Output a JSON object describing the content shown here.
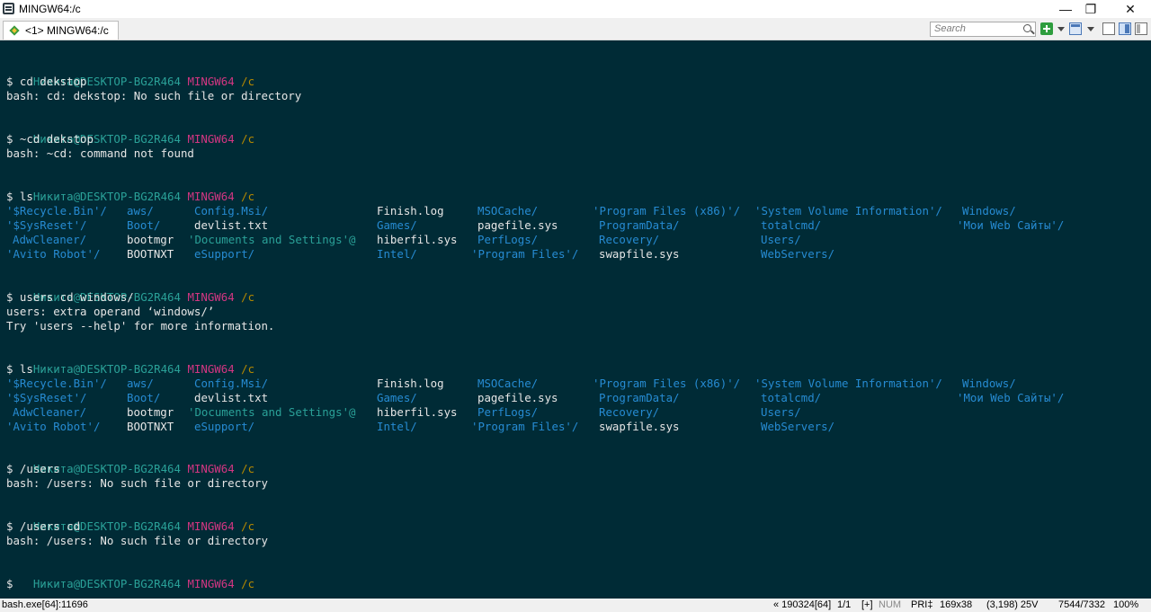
{
  "window": {
    "title": "MINGW64:/c",
    "tab_label": "<1> MINGW64:/c",
    "search_placeholder": "Search",
    "minimize": "—",
    "restore": "❐",
    "close": "✕"
  },
  "prompt": {
    "user": "Никита@DESKTOP-BG2R464",
    "system": "MINGW64",
    "path": "/c"
  },
  "terminal": {
    "cmd1": "$ cd dekstop",
    "out1": "bash: cd: dekstop: No such file or directory",
    "cmd2": "$ ~cd dekstop",
    "out2": "bash: ~cd: command not found",
    "cmd3": "$ ls",
    "cmd4": "$ users cd windows/",
    "out4a": "users: extra operand ‘windows/’",
    "out4b": "Try 'users --help' for more information.",
    "cmd5": "$ ls",
    "cmd6": "$ /users",
    "out6": "bash: /users: No such file or directory",
    "cmd7": "$ /users cd",
    "out7": "bash: /users: No such file or directory",
    "cmd8": "$"
  },
  "ls_listing": [
    [
      "'$Recycle.Bin'/",
      "aws/",
      "Config.Msi/",
      "Finish.log",
      "MSOCache/",
      "'Program Files (x86)'/",
      "'System Volume Information'/",
      "Windows/"
    ],
    [
      "'$SysReset'/",
      "Boot/",
      "devlist.txt",
      "Games/",
      "pagefile.sys",
      "ProgramData/",
      "totalcmd/",
      "'Мои Web Сайты'/"
    ],
    [
      "AdwCleaner/",
      "bootmgr",
      "'Documents and Settings'@",
      "hiberfil.sys",
      "PerfLogs/",
      "Recovery/",
      "Users/",
      ""
    ],
    [
      "'Avito Robot'/",
      "BOOTNXT",
      "eSupport/",
      "Intel/",
      "'Program Files'/",
      "swapfile.sys",
      "WebServers/",
      ""
    ]
  ],
  "status": {
    "process": "bash.exe[64]:11696",
    "position": "« 190324[64]",
    "page": "1/1",
    "mode": "[+]",
    "num": "NUM",
    "pri": "PRI‡",
    "size": "169x38",
    "cursor": "(3,198) 25V",
    "memory": "7544/7332",
    "zoom": "100%"
  },
  "colors": {
    "background": "#002b36",
    "prompt_user": "#2aa198",
    "prompt_system": "#d33682",
    "prompt_path": "#b58900",
    "directory": "#268bd2"
  }
}
